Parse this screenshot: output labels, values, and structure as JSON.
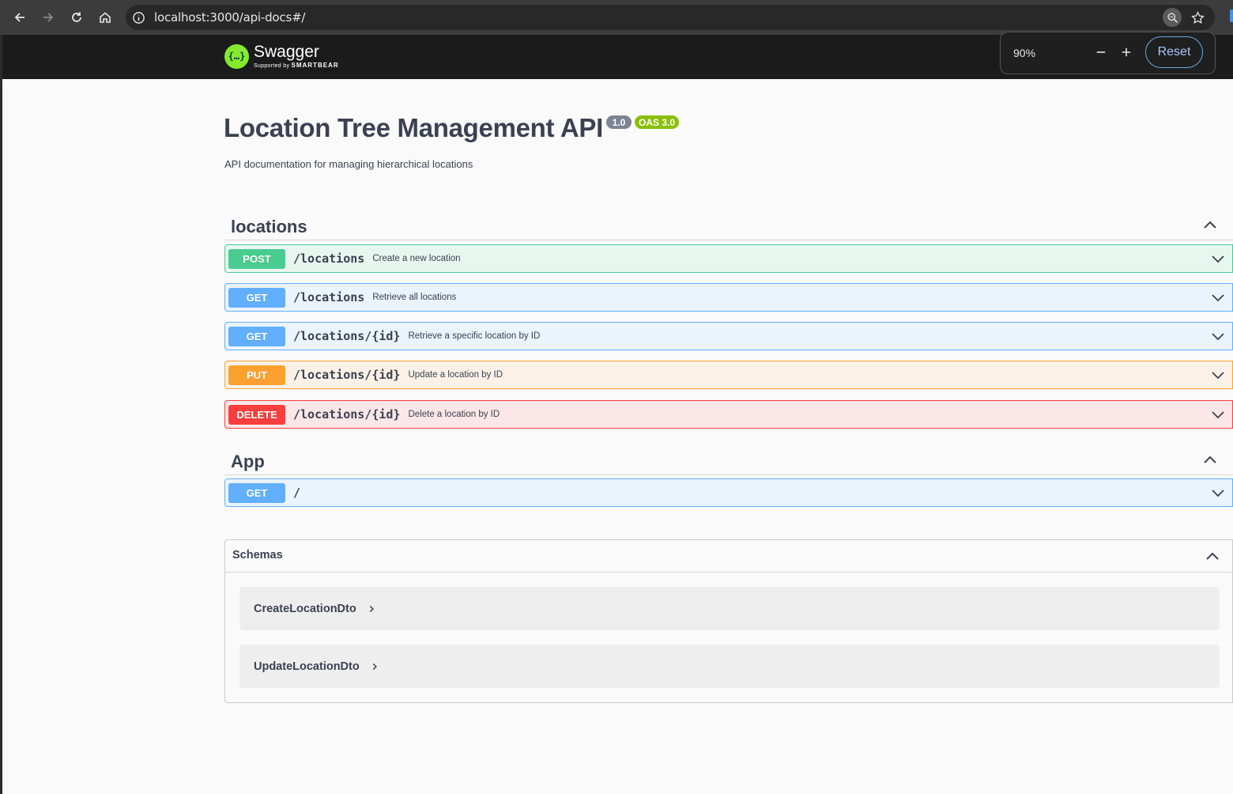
{
  "browser": {
    "url": "localhost:3000/api-docs#/",
    "zoom": {
      "level": "90%",
      "minus": "−",
      "plus": "+",
      "reset": "Reset"
    }
  },
  "topbar": {
    "logo_name": "Swagger",
    "logo_sub_prefix": "Supported by",
    "logo_sub_brand": "SMARTBEAR",
    "logo_glyph": "{…}"
  },
  "info": {
    "title": "Location Tree Management API",
    "version": "1.0",
    "oas": "OAS 3.0",
    "description": "API documentation for managing hierarchical locations"
  },
  "tags": [
    {
      "name": "locations",
      "operations": [
        {
          "method": "POST",
          "path": "/locations",
          "summary": "Create a new location"
        },
        {
          "method": "GET",
          "path": "/locations",
          "summary": "Retrieve all locations"
        },
        {
          "method": "GET",
          "path": "/locations/{id}",
          "summary": "Retrieve a specific location by ID"
        },
        {
          "method": "PUT",
          "path": "/locations/{id}",
          "summary": "Update a location by ID"
        },
        {
          "method": "DELETE",
          "path": "/locations/{id}",
          "summary": "Delete a location by ID"
        }
      ]
    },
    {
      "name": "App",
      "operations": [
        {
          "method": "GET",
          "path": "/",
          "summary": ""
        }
      ]
    }
  ],
  "schemas": {
    "title": "Schemas",
    "models": [
      "CreateLocationDto",
      "UpdateLocationDto"
    ]
  },
  "colors": {
    "post": "#49cc90",
    "get": "#61affe",
    "put": "#fca130",
    "delete": "#f93e3e",
    "swagger_green": "#85ea2d"
  }
}
